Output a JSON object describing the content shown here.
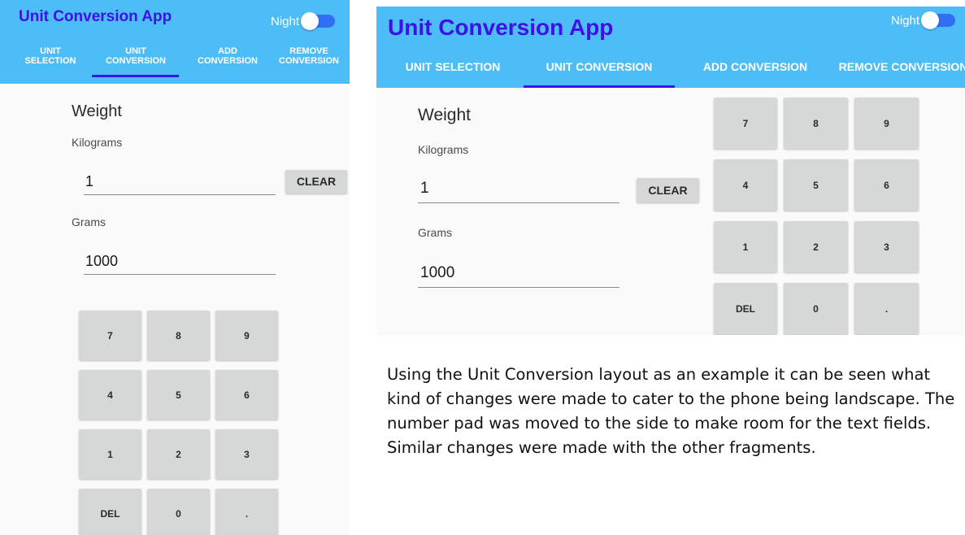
{
  "app": {
    "title": "Unit Conversion App",
    "night_label": "Night"
  },
  "colors": {
    "appbar": "#4dbdf8",
    "accent": "#4010e8",
    "switch_track": "#2f6ff2",
    "key_background": "#d6d7d7"
  },
  "portrait": {
    "tabs": [
      {
        "label": "UNIT\nSELECTION",
        "selected": false
      },
      {
        "label": "UNIT\nCONVERSION",
        "selected": true
      },
      {
        "label": "ADD\nCONVERSION",
        "selected": false
      },
      {
        "label": "REMOVE\nCONVERSION",
        "selected": false
      }
    ]
  },
  "landscape": {
    "tabs": [
      {
        "label": "UNIT SELECTION",
        "selected": false
      },
      {
        "label": "UNIT CONVERSION",
        "selected": true
      },
      {
        "label": "ADD CONVERSION",
        "selected": false
      },
      {
        "label": "REMOVE CONVERSION",
        "selected": false
      }
    ]
  },
  "converter": {
    "category": "Weight",
    "from_unit": "Kilograms",
    "from_value": "1",
    "to_unit": "Grams",
    "to_value": "1000",
    "clear_label": "CLEAR"
  },
  "keypad": [
    "7",
    "8",
    "9",
    "4",
    "5",
    "6",
    "1",
    "2",
    "3",
    "DEL",
    "0",
    "."
  ],
  "caption": "Using the Unit Conversion layout as an example it can be seen what kind of changes were made to cater to the phone being landscape. The number pad was moved to the side to make room for the text fields. Similar changes were made with the other fragments."
}
